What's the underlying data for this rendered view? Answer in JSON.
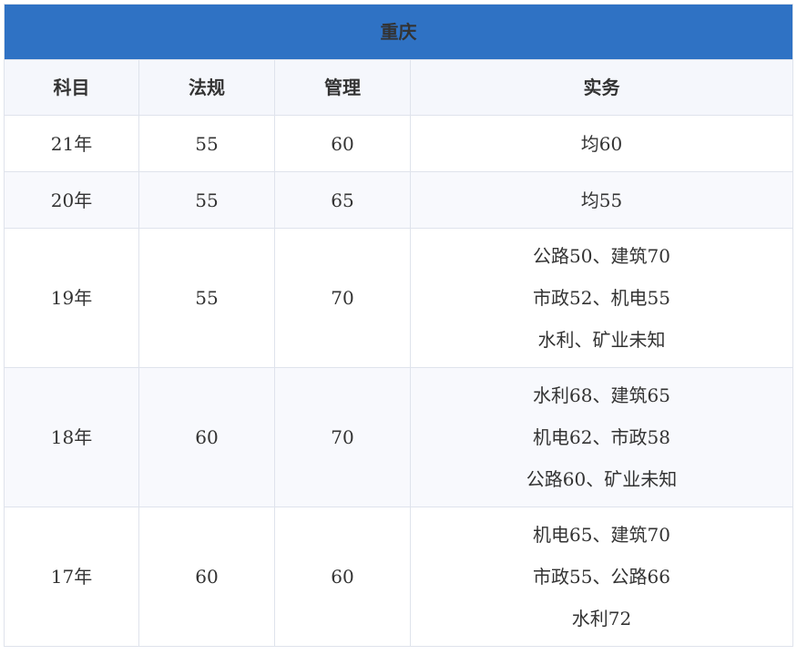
{
  "table": {
    "title": "重庆",
    "headers": [
      "科目",
      "法规",
      "管理",
      "实务"
    ],
    "rows": [
      {
        "year": "21年",
        "fagui": "55",
        "guanli": "60",
        "shiwu": [
          "均60"
        ]
      },
      {
        "year": "20年",
        "fagui": "55",
        "guanli": "65",
        "shiwu": [
          "均55"
        ]
      },
      {
        "year": "19年",
        "fagui": "55",
        "guanli": "70",
        "shiwu": [
          "公路50、建筑70",
          "市政52、机电55",
          "水利、矿业未知"
        ]
      },
      {
        "year": "18年",
        "fagui": "60",
        "guanli": "70",
        "shiwu": [
          "水利68、建筑65",
          "机电62、市政58",
          "公路60、矿业未知"
        ]
      },
      {
        "year": "17年",
        "fagui": "60",
        "guanli": "60",
        "shiwu": [
          "机电65、建筑70",
          "市政55、公路66",
          "水利72"
        ]
      }
    ]
  },
  "colors": {
    "title_bg": "#2f72c4",
    "title_text": "#ffffff",
    "header_bg": "#f5f7fc",
    "border": "#dfe3ec",
    "stripe_bg": "#f8f9fd"
  }
}
